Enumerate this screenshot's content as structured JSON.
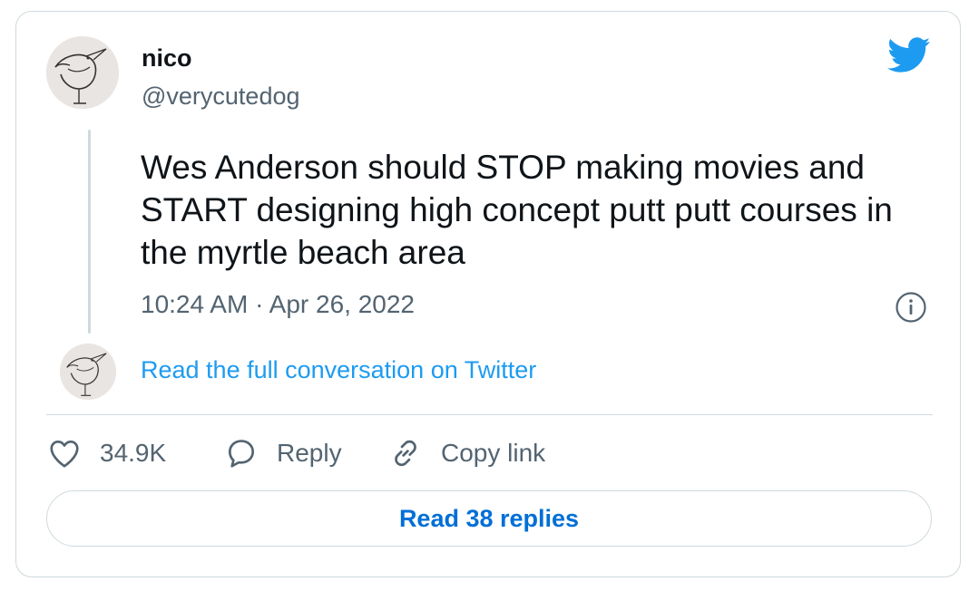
{
  "author": {
    "display_name": "nico",
    "handle": "@verycutedog",
    "avatar_icon": "bird-drawing-avatar-icon"
  },
  "tweet": {
    "text": "Wes Anderson should STOP making movies and START designing high concept putt putt courses in the myrtle beach area",
    "timestamp": "10:24 AM · Apr 26, 2022"
  },
  "links": {
    "read_full": "Read the full conversation on Twitter"
  },
  "actions": {
    "like_count": "34.9K",
    "reply_label": "Reply",
    "copy_label": "Copy link"
  },
  "replies_button": "Read 38 replies",
  "colors": {
    "brand": "#1d9bf0",
    "link_button": "#006fd6",
    "secondary_text": "#536471",
    "border": "#cfd9de"
  },
  "icons": {
    "logo": "twitter-bird-icon",
    "info": "info-icon",
    "like": "heart-icon",
    "reply": "speech-bubble-icon",
    "copy": "link-icon"
  }
}
